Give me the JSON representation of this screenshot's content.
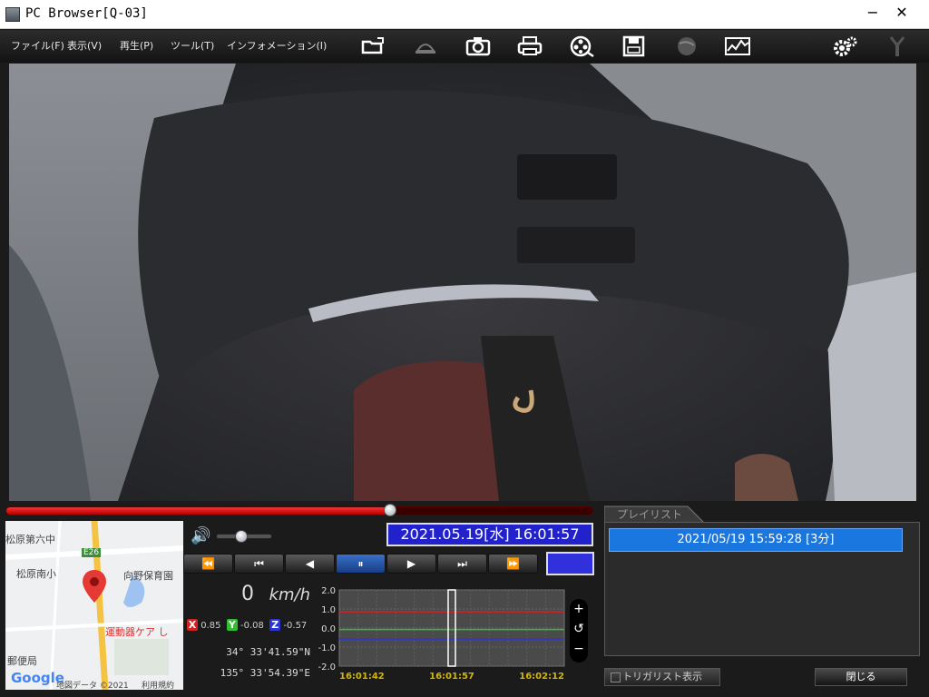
{
  "window": {
    "title": "PC Browser[Q-03]",
    "minimize_label": "−",
    "close_label": "✕"
  },
  "menu": {
    "items": [
      "ファイル(F)",
      "表示(V)",
      "再生(P)",
      "ツール(T)",
      "インフォメーション(I)"
    ]
  },
  "toolbar": {
    "icons": [
      "open-folder-icon",
      "camera-view-icon",
      "snapshot-camera-icon",
      "print-icon",
      "film-reel-icon",
      "save-disk-icon",
      "globe-icon",
      "graph-icon",
      "settings-gears-icon",
      "antenna-icon"
    ]
  },
  "playback": {
    "progress": 0.655,
    "volume": 0.45,
    "datetime": "2021.05.19[水] 16:01:57",
    "transport_buttons": [
      "⏪",
      "⏮",
      "◀",
      "⏸",
      "▶",
      "⏭",
      "⏩"
    ],
    "active_button": 3,
    "speed_value": "0",
    "speed_unit": "km/h"
  },
  "gsensor": {
    "x_label": "X",
    "x_value": "0.85",
    "y_label": "Y",
    "y_value": "-0.08",
    "z_label": "Z",
    "z_value": "-0.57",
    "x_color": "#d32020",
    "y_color": "#2fbf2f",
    "z_color": "#2a35d8"
  },
  "location": {
    "latitude": "34° 33'41.59\"N",
    "longitude": "135° 33'54.39\"E"
  },
  "map": {
    "labels": [
      "松原第六中",
      "E26",
      "松原南小",
      "向野保育園",
      "運動器ケア し",
      "郵便局"
    ],
    "provider": "Google",
    "attribution": "地図データ ©2021",
    "terms": "利用規約"
  },
  "chart_data": {
    "type": "line",
    "y_ticks": [
      "2.0",
      "1.0",
      "0.0",
      "-1.0",
      "-2.0"
    ],
    "ylim": [
      -2.0,
      2.0
    ],
    "x_ticks": [
      "16:01:42",
      "16:01:57",
      "16:02:12"
    ],
    "series": [
      {
        "name": "X",
        "color": "#d32020",
        "value": 0.85
      },
      {
        "name": "Y",
        "color": "#2fbf2f",
        "value": -0.08
      },
      {
        "name": "Z",
        "color": "#2a35d8",
        "value": -0.57
      }
    ]
  },
  "zoom": {
    "buttons": [
      "+",
      "↺",
      "−"
    ]
  },
  "playlist": {
    "tab_label": "プレイリスト",
    "items": [
      "2021/05/19 15:59:28 [3分]"
    ],
    "trigger_label": "トリガリスト表示",
    "close_label": "閉じる"
  }
}
